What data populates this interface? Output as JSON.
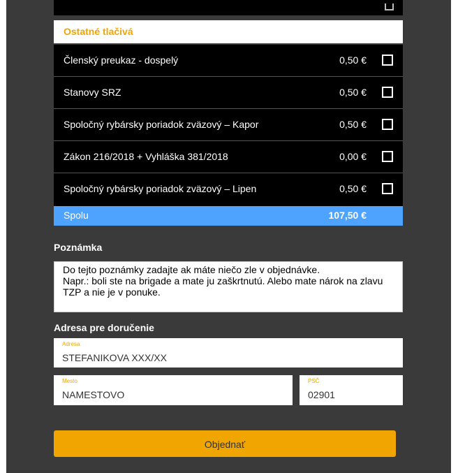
{
  "section_title": "Ostatné tlačivá",
  "items": [
    {
      "name": "Členský preukaz - dospelý",
      "price": "0,50 €"
    },
    {
      "name": "Stanovy SRZ",
      "price": "0,50 €"
    },
    {
      "name": "Spoločný rybársky poriadok zväzový – Kapor",
      "price": "0,50 €"
    },
    {
      "name": "Zákon 216/2018 + Vyhláška 381/2018",
      "price": "0,00 €"
    },
    {
      "name": "Spoločný rybársky poriadok zväzový – Lipen",
      "price": "0,50 €"
    }
  ],
  "total": {
    "label": "Spolu",
    "value": "107,50 €"
  },
  "note": {
    "label": "Poznámka",
    "text": "Do tejto poznámky zadajte ak máte niečo zle v objednávke.\nNapr.: boli ste na brigade a mate ju zaškrtnutú. Alebo mate nárok na zlavu TZP a nie je v ponuke."
  },
  "address": {
    "label": "Adresa pre doručenie",
    "street": {
      "label": "Adresa",
      "value": "STEFANIKOVA XXX/XX"
    },
    "city": {
      "label": "Mesto",
      "value": "NAMESTOVO"
    },
    "zip": {
      "label": "PSČ",
      "value": "02901"
    }
  },
  "submit_label": "Objednať",
  "colors": {
    "accent": "#f0a500",
    "total_bar": "#4da3ff",
    "background": "#3a3a3a",
    "row_background": "#000000"
  }
}
